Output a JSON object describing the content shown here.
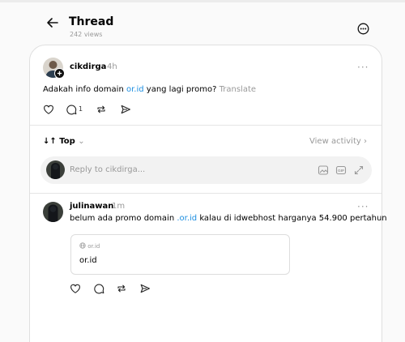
{
  "header": {
    "title": "Thread",
    "views": "242 views"
  },
  "post": {
    "username": "cikdirga",
    "time": "4h",
    "text_before": "Adakah info domain ",
    "text_link": "or.id",
    "text_after": " yang lagi promo?",
    "translate": "Translate",
    "reply_count": "1"
  },
  "sort": {
    "label": "Top",
    "arrows": "↓↑",
    "chevron": "⌄",
    "view_activity": "View activity",
    "view_activity_chevron": "›"
  },
  "reply_input": {
    "placeholder": "Reply to cikdirga..."
  },
  "reply": {
    "username": "julinawan",
    "time": "1m",
    "text_before": "belum ada promo domain ",
    "text_link": ".or.id",
    "text_after": " kalau di idwebhost harganya 54.900 pertahun",
    "preview_domain": "or.id",
    "preview_title": "or.id"
  },
  "icons": {
    "back": "arrow-left-icon",
    "more": "more-circle-icon",
    "like": "heart-icon",
    "comment": "comment-icon",
    "repost": "repost-icon",
    "share": "send-icon",
    "gif": "gif-icon",
    "image": "image-icon",
    "expand": "expand-icon",
    "globe": "globe-icon"
  },
  "colors": {
    "link": "#1d8ee0",
    "muted": "#999999",
    "border": "#e0e0e0"
  }
}
